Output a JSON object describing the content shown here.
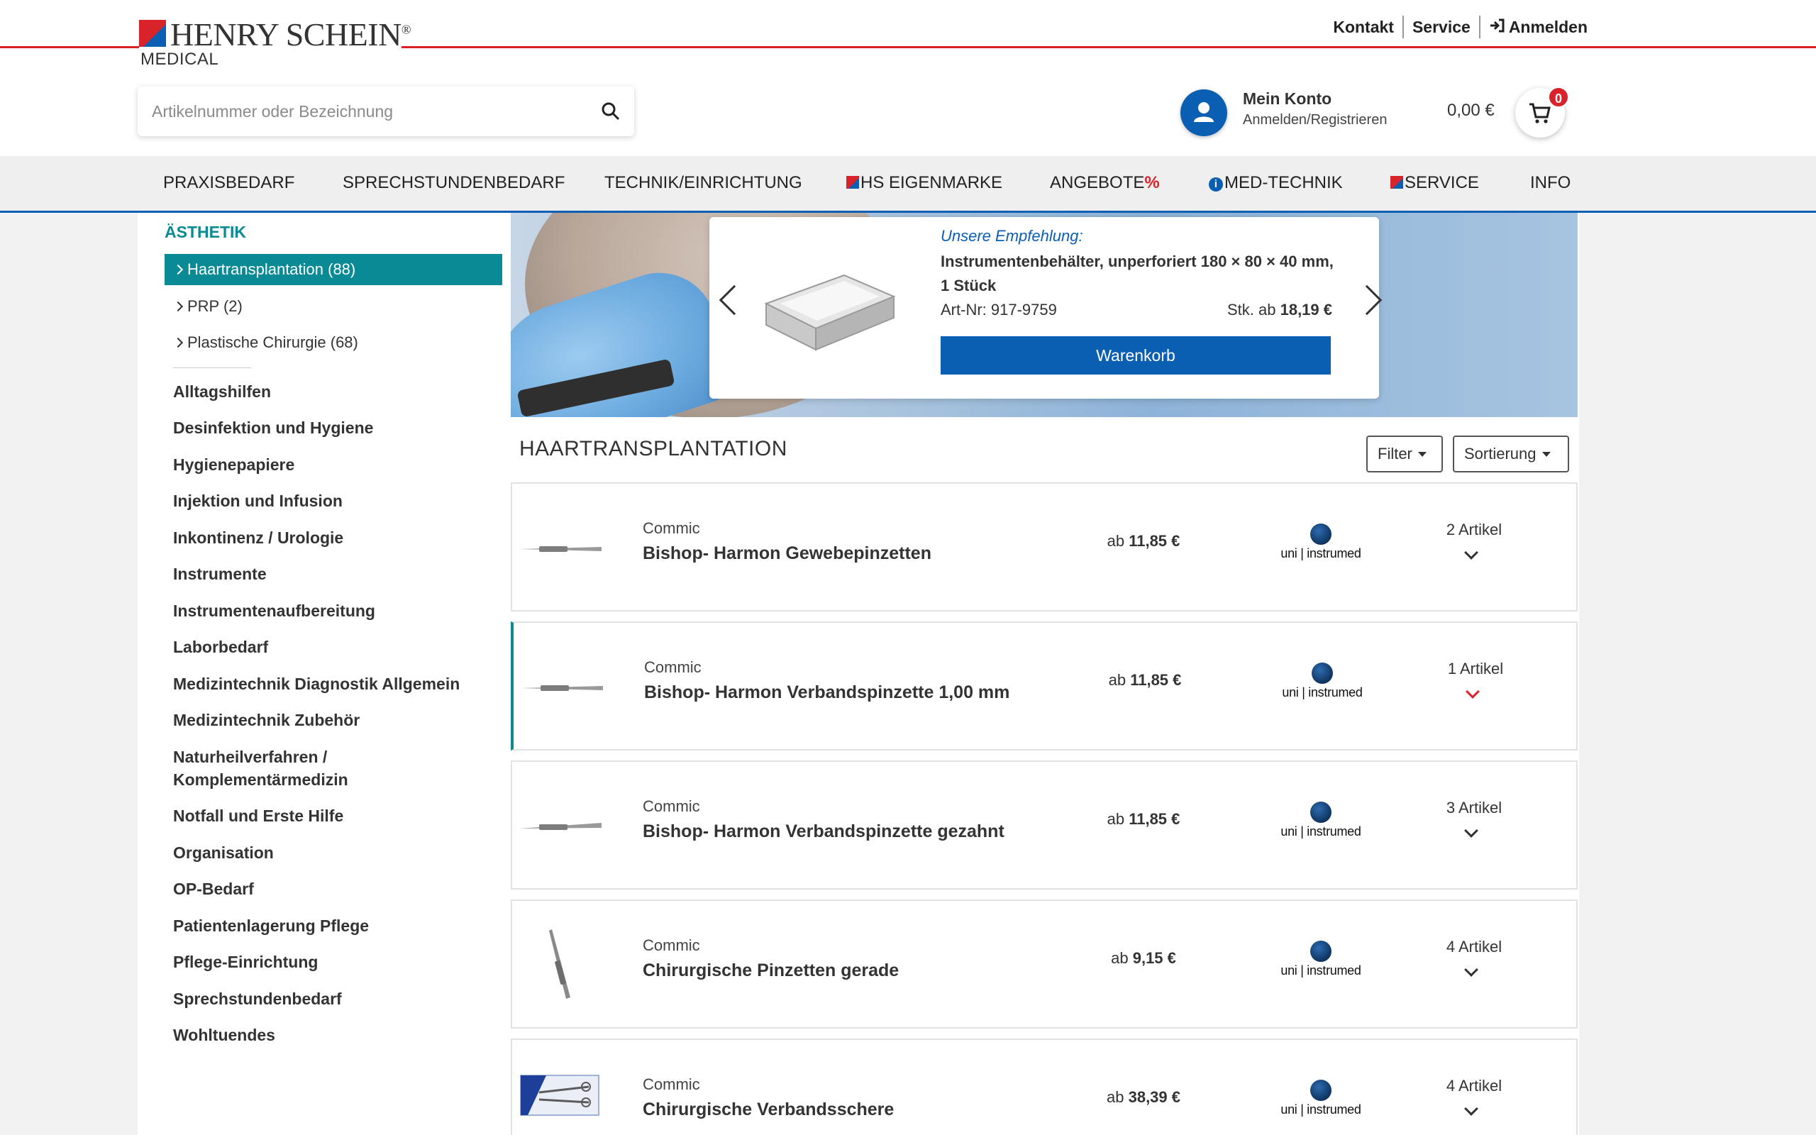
{
  "brand": {
    "name": "HENRY SCHEIN",
    "registered": "®",
    "sub": "MEDICAL",
    "colors": {
      "red": "#d8232a",
      "blue": "#0b5fb3",
      "teal": "#0a8a95"
    }
  },
  "toplinks": {
    "kontakt": "Kontakt",
    "service": "Service",
    "login": "Anmelden"
  },
  "search": {
    "placeholder": "Artikelnummer oder Bezeichnung",
    "icon": "search-icon"
  },
  "account": {
    "title": "Mein Konto",
    "subtitle": "Anmelden/Registrieren",
    "icon": "user-icon"
  },
  "cart": {
    "total": "0,00 €",
    "count": "0",
    "icon": "cart-icon"
  },
  "nav": {
    "praxisbedarf": "PRAXISBEDARF",
    "sprechstundenbedarf": "SPRECHSTUNDENBEDARF",
    "technik": "TECHNIK/EINRICHTUNG",
    "eigenmarke": "HS EIGENMARKE",
    "angebote": "ANGEBOTE",
    "angebote_pct": "%",
    "medtechnik": "MED-TECHNIK",
    "medtechnik_badge": "i",
    "service": "SERVICE",
    "info": "INFO"
  },
  "sidebar": {
    "heading": "ÄSTHETIK",
    "subcategories": [
      {
        "label": "Haartransplantation (88)",
        "active": true
      },
      {
        "label": "PRP (2)",
        "active": false
      },
      {
        "label": "Plastische Chirurgie (68)",
        "active": false
      }
    ],
    "categories": [
      "Alltagshilfen",
      "Desinfektion und Hygiene",
      "Hygienepapiere",
      "Injektion und Infusion",
      "Inkontinenz / Urologie",
      "Instrumente",
      "Instrumentenaufbereitung",
      "Laborbedarf",
      "Medizintechnik Diagnostik Allgemein",
      "Medizintechnik Zubehör",
      "Naturheilverfahren / Komplementärmedizin",
      "Notfall und Erste Hilfe",
      "Organisation",
      "OP-Bedarf",
      "Patientenlagerung Pflege",
      "Pflege-Einrichtung",
      "Sprechstundenbedarf",
      "Wohltuendes"
    ]
  },
  "recommendation": {
    "label": "Unsere Empfehlung:",
    "title": "Instrumentenbehälter, unperforiert 180 × 80 × 40 mm, 1 Stück",
    "article_no": "Art-Nr: 917-9759",
    "price_prefix": "Stk. ab",
    "price": "18,19 €",
    "button": "Warenkorb"
  },
  "list": {
    "title": "HAARTRANSPLANTATION",
    "filter": "Filter",
    "sort": "Sortierung"
  },
  "products": [
    {
      "brand": "Commic",
      "name": "Bishop- Harmon Gewebepinzetten",
      "price_prefix": "ab",
      "price": "11,85 €",
      "manufacturer": "uni | instrumed",
      "count": "2 Artikel",
      "image": "tweezers"
    },
    {
      "brand": "Commic",
      "name": "Bishop- Harmon Verbandspinzette 1,00 mm",
      "price_prefix": "ab",
      "price": "11,85 €",
      "manufacturer": "uni | instrumed",
      "count": "1 Artikel",
      "image": "tweezers"
    },
    {
      "brand": "Commic",
      "name": "Bishop- Harmon Verbandspinzette gezahnt",
      "price_prefix": "ab",
      "price": "11,85 €",
      "manufacturer": "uni | instrumed",
      "count": "3 Artikel",
      "image": "tweezers"
    },
    {
      "brand": "Commic",
      "name": "Chirurgische Pinzetten gerade",
      "price_prefix": "ab",
      "price": "9,15 €",
      "manufacturer": "uni | instrumed",
      "count": "4 Artikel",
      "image": "tweezers"
    },
    {
      "brand": "Commic",
      "name": "Chirurgische Verbandsschere",
      "price_prefix": "ab",
      "price": "38,39 €",
      "manufacturer": "uni | instrumed",
      "count": "4 Artikel",
      "image": "scissors-package"
    }
  ]
}
